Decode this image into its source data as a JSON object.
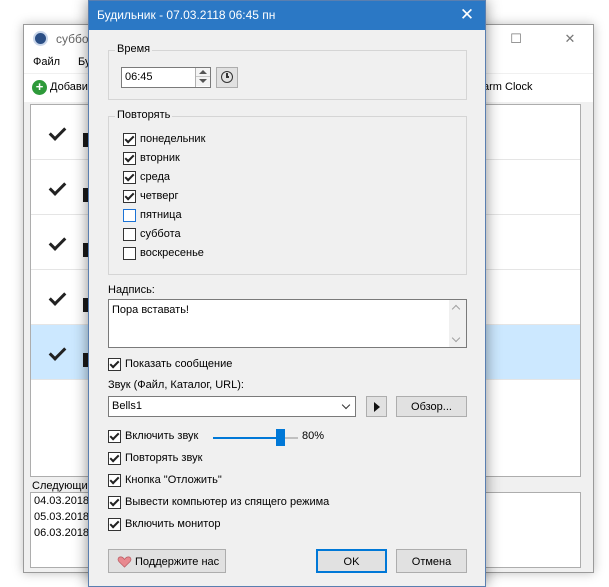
{
  "main_window": {
    "title": "суббота",
    "menu": [
      "Файл",
      "Бу"
    ],
    "toolbar": {
      "add_label": "Добавит",
      "right_label": "arm Clock"
    },
    "alarm_rows": [
      {
        "checked": true,
        "selected": false
      },
      {
        "checked": true,
        "selected": false
      },
      {
        "checked": true,
        "selected": false
      },
      {
        "checked": true,
        "selected": false
      },
      {
        "checked": true,
        "selected": true
      }
    ],
    "next_label": "Следующие",
    "next_dates": [
      "04.03.2018",
      "05.03.2018",
      "06.03.2018"
    ]
  },
  "dialog": {
    "title": "Будильник - 07.03.2118 06:45 пн",
    "time_group": "Время",
    "time_value": "06:45",
    "repeat_group": "Повторять",
    "days": [
      {
        "label": "понедельник",
        "checked": true
      },
      {
        "label": "вторник",
        "checked": true
      },
      {
        "label": "среда",
        "checked": true
      },
      {
        "label": "четверг",
        "checked": true
      },
      {
        "label": "пятница",
        "checked": false
      },
      {
        "label": "суббота",
        "checked": false
      },
      {
        "label": "воскресенье",
        "checked": false
      }
    ],
    "caption_label": "Надпись:",
    "caption_text": "Пора вставать!",
    "show_message": {
      "label": "Показать сообщение",
      "checked": true
    },
    "sound_label": "Звук (Файл, Каталог, URL):",
    "sound_value": "Bells1",
    "browse_label": "Обзор...",
    "enable_sound": {
      "label": "Включить звук",
      "checked": true
    },
    "volume_percent": 80,
    "volume_text": "80%",
    "repeat_sound": {
      "label": "Повторять звук",
      "checked": true
    },
    "snooze_button": {
      "label": "Кнопка \"Отложить\"",
      "checked": true
    },
    "wake_computer": {
      "label": "Вывести компьютер из спящего режима",
      "checked": true
    },
    "enable_monitor": {
      "label": "Включить монитор",
      "checked": true
    },
    "support_label": "Поддержите нас",
    "ok_label": "OK",
    "cancel_label": "Отмена"
  },
  "colors": {
    "titlebar": "#2b78c5",
    "accent": "#0078d7",
    "selection": "#cce8ff"
  },
  "icons": [
    "app-clock-icon",
    "add-icon",
    "close-icon",
    "clock-icon",
    "play-icon",
    "heart-icon"
  ]
}
